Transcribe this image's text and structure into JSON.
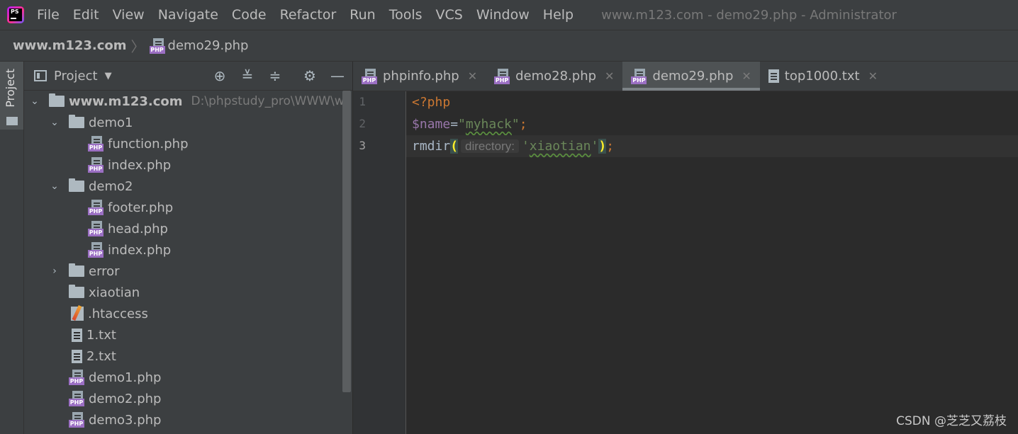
{
  "menubar": {
    "logo_text": "PS",
    "items": [
      "File",
      "Edit",
      "View",
      "Navigate",
      "Code",
      "Refactor",
      "Run",
      "Tools",
      "VCS",
      "Window",
      "Help"
    ],
    "window_title": "www.m123.com - demo29.php - Administrator"
  },
  "breadcrumb": {
    "root": "www.m123.com",
    "separator": "〉",
    "file": "demo29.php"
  },
  "toolstrip": {
    "project_label": "Project"
  },
  "project_panel": {
    "title": "Project",
    "tree": [
      {
        "label": "www.m123.com",
        "path": "D:\\phpstudy_pro\\WWW\\www",
        "icon": "folder-icon",
        "expanded": true
      },
      {
        "label": "demo1",
        "icon": "folder-icon",
        "expanded": true
      },
      {
        "label": "function.php",
        "icon": "php-file-icon"
      },
      {
        "label": "index.php",
        "icon": "php-file-icon"
      },
      {
        "label": "demo2",
        "icon": "folder-icon",
        "expanded": true
      },
      {
        "label": "footer.php",
        "icon": "php-file-icon"
      },
      {
        "label": "head.php",
        "icon": "php-file-icon"
      },
      {
        "label": "index.php",
        "icon": "php-file-icon"
      },
      {
        "label": "error",
        "icon": "folder-icon",
        "expanded": false
      },
      {
        "label": "xiaotian",
        "icon": "folder-icon"
      },
      {
        "label": ".htaccess",
        "icon": "htaccess-file-icon"
      },
      {
        "label": "1.txt",
        "icon": "text-file-icon"
      },
      {
        "label": "2.txt",
        "icon": "text-file-icon"
      },
      {
        "label": "demo1.php",
        "icon": "php-file-icon"
      },
      {
        "label": "demo2.php",
        "icon": "php-file-icon"
      },
      {
        "label": "demo3.php",
        "icon": "php-file-icon"
      }
    ]
  },
  "editor": {
    "tabs": [
      {
        "label": "phpinfo.php",
        "icon": "php-file-icon",
        "active": false
      },
      {
        "label": "demo28.php",
        "icon": "php-file-icon",
        "active": false
      },
      {
        "label": "demo29.php",
        "icon": "php-file-icon",
        "active": true
      },
      {
        "label": "top1000.txt",
        "icon": "text-file-icon",
        "active": false
      }
    ],
    "close_glyph": "✕",
    "line_numbers": [
      "1",
      "2",
      "3"
    ],
    "code": {
      "line1": "<?php",
      "line2_var": "$name",
      "line2_eq": "=",
      "line2_q1": "\"",
      "line2_str": "myhack",
      "line2_q2": "\"",
      "line2_semi": ";",
      "line3_fn": "rmdir",
      "line3_open": "(",
      "line3_hint": "directory:",
      "line3_q1": "'",
      "line3_str": "xiaotian",
      "line3_q2": "'",
      "line3_close": ")",
      "line3_semi": ";"
    }
  },
  "watermark": "CSDN @芝芝又荔枝",
  "colors": {
    "background": "#2b2b2b",
    "panel": "#3c3f41",
    "keyword": "#cc7832",
    "variable": "#9876aa",
    "string": "#6a8759",
    "php_badge": "#9b6fc3"
  }
}
